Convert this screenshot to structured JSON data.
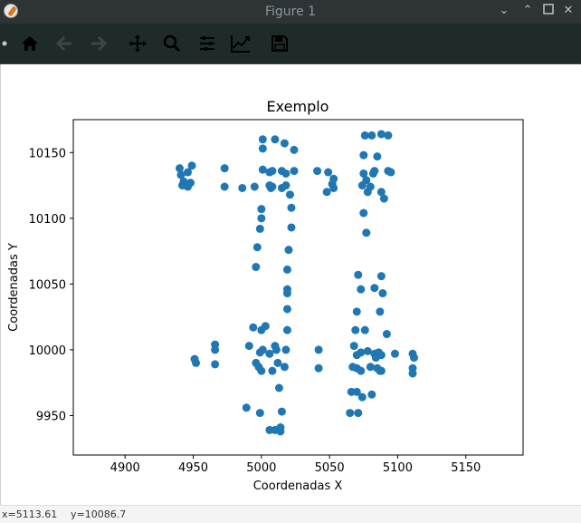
{
  "window": {
    "title": "Figure 1",
    "controls": [
      "minimize-icon",
      "maximize-icon",
      "close-icon"
    ]
  },
  "toolbar": {
    "tools": [
      "home-icon",
      "back-arrow-icon",
      "forward-arrow-icon",
      "pan-icon",
      "zoom-icon",
      "subplots-icon",
      "axes-edit-icon",
      "save-icon"
    ]
  },
  "status": {
    "x_text": "x=5113.61",
    "y_text": "y=10086.7"
  },
  "colors": {
    "marker": "#1f77b4",
    "titlebar": "#2e3436",
    "toolbar": "#1f2b29"
  },
  "chart_data": {
    "type": "scatter",
    "title": "Exemplo",
    "xlabel": "Coordenadas X",
    "ylabel": "Coordenadas Y",
    "xlim": [
      4862,
      5192
    ],
    "ylim": [
      9920,
      10175
    ],
    "xticks": [
      4900,
      4950,
      5000,
      5050,
      5100,
      5150
    ],
    "yticks": [
      9950,
      10000,
      10050,
      10100,
      10150
    ],
    "grid": false,
    "series": [
      {
        "color": "#1f77b4",
        "points": [
          [
            4940,
            10138
          ],
          [
            4941,
            10133
          ],
          [
            4943,
            10128
          ],
          [
            4946,
            10135
          ],
          [
            4949,
            10140
          ],
          [
            4942,
            10125
          ],
          [
            4948,
            10127
          ],
          [
            4946,
            10124
          ],
          [
            4973,
            10138
          ],
          [
            4973,
            10124
          ],
          [
            4986,
            10123
          ],
          [
            4995,
            10124
          ],
          [
            5001,
            10160
          ],
          [
            5001,
            10153
          ],
          [
            5010,
            10160
          ],
          [
            5017,
            10157
          ],
          [
            5024,
            10152
          ],
          [
            5001,
            10137
          ],
          [
            5006,
            10135
          ],
          [
            5008,
            10136
          ],
          [
            5015,
            10136
          ],
          [
            5018,
            10134
          ],
          [
            5024,
            10136
          ],
          [
            5006,
            10125
          ],
          [
            5008,
            10124
          ],
          [
            5007,
            10123
          ],
          [
            5015,
            10123
          ],
          [
            5018,
            10125
          ],
          [
            5021,
            10118
          ],
          [
            5000,
            10107
          ],
          [
            5000,
            10100
          ],
          [
            5022,
            10108
          ],
          [
            5022,
            10093
          ],
          [
            4999,
            10092
          ],
          [
            4997,
            10078
          ],
          [
            5020,
            10076
          ],
          [
            5019,
            10061
          ],
          [
            4996,
            10063
          ],
          [
            5019,
            10046
          ],
          [
            5019,
            10043
          ],
          [
            5019,
            10031
          ],
          [
            5019,
            10015
          ],
          [
            5003,
            10018
          ],
          [
            5000,
            10015
          ],
          [
            4994,
            10017
          ],
          [
            4991,
            10003
          ],
          [
            4999,
            9998
          ],
          [
            5001,
            10000
          ],
          [
            5010,
            10003
          ],
          [
            5011,
            10000
          ],
          [
            5018,
            10000
          ],
          [
            5006,
            9997
          ],
          [
            4996,
            9990
          ],
          [
            4998,
            9987
          ],
          [
            5000,
            9984
          ],
          [
            5008,
            9984
          ],
          [
            5012,
            9990
          ],
          [
            5017,
            9987
          ],
          [
            4966,
            10004
          ],
          [
            4966,
            10000
          ],
          [
            4966,
            9989
          ],
          [
            4951,
            9993
          ],
          [
            4952,
            9990
          ],
          [
            5013,
            9971
          ],
          [
            5015,
            9953
          ],
          [
            4989,
            9956
          ],
          [
            4999,
            9952
          ],
          [
            5006,
            9939
          ],
          [
            5010,
            9939
          ],
          [
            5014,
            9941
          ],
          [
            5014,
            9938
          ],
          [
            5041,
            10136
          ],
          [
            5049,
            10135
          ],
          [
            5053,
            10130
          ],
          [
            5052,
            10126
          ],
          [
            5048,
            10120
          ],
          [
            5053,
            10123
          ],
          [
            5076,
            10163
          ],
          [
            5081,
            10163
          ],
          [
            5088,
            10164
          ],
          [
            5093,
            10163
          ],
          [
            5075,
            10148
          ],
          [
            5085,
            10147
          ],
          [
            5075,
            10134
          ],
          [
            5082,
            10134
          ],
          [
            5093,
            10136
          ],
          [
            5095,
            10135
          ],
          [
            5083,
            10136
          ],
          [
            5077,
            10129
          ],
          [
            5080,
            10124
          ],
          [
            5074,
            10125
          ],
          [
            5078,
            10120
          ],
          [
            5088,
            10120
          ],
          [
            5090,
            10115
          ],
          [
            5075,
            10104
          ],
          [
            5077,
            10089
          ],
          [
            5071,
            10057
          ],
          [
            5073,
            10046
          ],
          [
            5083,
            10047
          ],
          [
            5088,
            10056
          ],
          [
            5089,
            10043
          ],
          [
            5087,
            10029
          ],
          [
            5070,
            10029
          ],
          [
            5069,
            10015
          ],
          [
            5076,
            10015
          ],
          [
            5092,
            10012
          ],
          [
            5068,
            10003
          ],
          [
            5073,
            9998
          ],
          [
            5070,
            9996
          ],
          [
            5078,
            9999
          ],
          [
            5083,
            9997
          ],
          [
            5086,
            9998
          ],
          [
            5088,
            9996
          ],
          [
            5084,
            9994
          ],
          [
            5098,
            9997
          ],
          [
            5111,
            9997
          ],
          [
            5112,
            9994
          ],
          [
            5067,
            9987
          ],
          [
            5070,
            9986
          ],
          [
            5073,
            9984
          ],
          [
            5080,
            9987
          ],
          [
            5085,
            9986
          ],
          [
            5087,
            9984
          ],
          [
            5088,
            9984
          ],
          [
            5111,
            9986
          ],
          [
            5111,
            9982
          ],
          [
            5042,
            9986
          ],
          [
            5066,
            9968
          ],
          [
            5070,
            9968
          ],
          [
            5074,
            9964
          ],
          [
            5081,
            9966
          ],
          [
            5065,
            9952
          ],
          [
            5071,
            9952
          ],
          [
            5042,
            10000
          ]
        ]
      }
    ]
  }
}
